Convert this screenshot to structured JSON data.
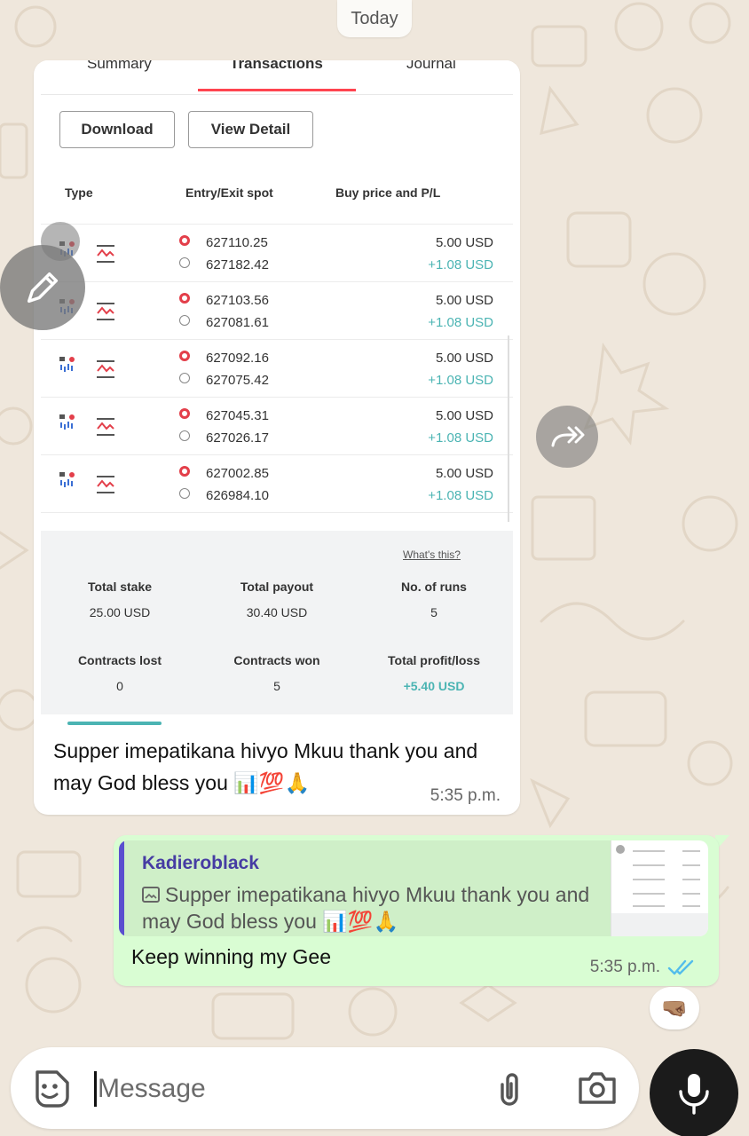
{
  "date_chip": "Today",
  "screenshot": {
    "tabs": [
      "Summary",
      "Transactions",
      "Journal"
    ],
    "active_tab": "Transactions",
    "buttons": {
      "download": "Download",
      "view_detail": "View Detail"
    },
    "columns": {
      "type": "Type",
      "spot": "Entry/Exit spot",
      "price": "Buy price and P/L"
    },
    "transactions": [
      {
        "entry": "627110.25",
        "exit": "627182.42",
        "buy_price": "5.00 USD",
        "pl": "+1.08 USD"
      },
      {
        "entry": "627103.56",
        "exit": "627081.61",
        "buy_price": "5.00 USD",
        "pl": "+1.08 USD"
      },
      {
        "entry": "627092.16",
        "exit": "627075.42",
        "buy_price": "5.00 USD",
        "pl": "+1.08 USD"
      },
      {
        "entry": "627045.31",
        "exit": "627026.17",
        "buy_price": "5.00 USD",
        "pl": "+1.08 USD"
      },
      {
        "entry": "627002.85",
        "exit": "626984.10",
        "buy_price": "5.00 USD",
        "pl": "+1.08 USD"
      }
    ],
    "summary": {
      "whats_this": "What's this?",
      "total_stake_label": "Total stake",
      "total_stake": "25.00 USD",
      "total_payout_label": "Total payout",
      "total_payout": "30.40 USD",
      "runs_label": "No. of runs",
      "runs": "5",
      "lost_label": "Contracts lost",
      "lost": "0",
      "won_label": "Contracts won",
      "won": "5",
      "profit_label": "Total profit/loss",
      "profit": "+5.40 USD"
    }
  },
  "incoming": {
    "caption": "Supper imepatikana hivyo Mkuu thank you and may God bless you 📊💯🙏",
    "time": "5:35 p.m."
  },
  "outgoing": {
    "quote_author": "Kadieroblack",
    "quote_text": "Supper imepatikana hivyo Mkuu thank you and may God bless you 📊💯🙏",
    "text": "Keep winning my Gee",
    "time": "5:35 p.m.",
    "status": "read"
  },
  "reaction": "🤜🏽",
  "input": {
    "placeholder": "Message"
  },
  "colors": {
    "wallpaper": "#efe7dc",
    "outgoing_bubble": "#d9fdd3",
    "quote_accent": "#5a4fcf",
    "profit_teal": "#4bb4b3",
    "entry_red": "#e33f4a",
    "read_ticks": "#53bdeb"
  },
  "icons": [
    "edit-pencil-icon",
    "forward-icon",
    "sticker-icon",
    "attach-icon",
    "camera-icon",
    "mic-icon",
    "image-icon",
    "double-check-icon"
  ]
}
